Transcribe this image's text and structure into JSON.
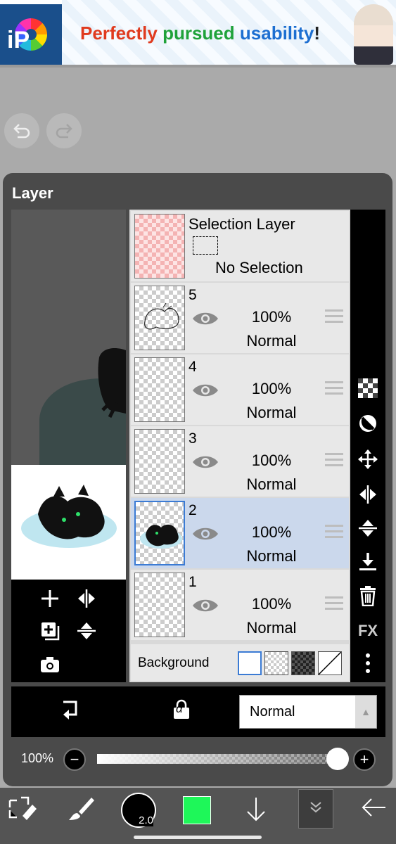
{
  "ad": {
    "logo_text": "iP",
    "headline_1": "Perfectly",
    "headline_2": "pursued",
    "headline_3": "usability",
    "headline_4": "!"
  },
  "history": {
    "undo_icon": "undo-icon",
    "redo_icon": "redo-icon"
  },
  "panel": {
    "title": "Layer",
    "selection_layer": {
      "name": "Selection Layer",
      "status": "No Selection"
    },
    "layers": [
      {
        "number": "5",
        "opacity": "100%",
        "blend": "Normal",
        "selected": false
      },
      {
        "number": "4",
        "opacity": "100%",
        "blend": "Normal",
        "selected": false
      },
      {
        "number": "3",
        "opacity": "100%",
        "blend": "Normal",
        "selected": false
      },
      {
        "number": "2",
        "opacity": "100%",
        "blend": "Normal",
        "selected": true
      },
      {
        "number": "1",
        "opacity": "100%",
        "blend": "Normal",
        "selected": false
      }
    ],
    "background": {
      "label": "Background",
      "selected_swatch": "white"
    },
    "side_tools": [
      "checker-icon",
      "contrast-icon",
      "move-icon",
      "flip-horizontal-icon",
      "flip-vertical-icon",
      "merge-down-icon",
      "trash-icon",
      "FX",
      "more-vertical-icon"
    ],
    "preview_tools": [
      "add-layer-icon",
      "flip-horizontal-icon",
      "duplicate-layer-icon",
      "flip-vertical-icon",
      "camera-icon"
    ]
  },
  "blend_bar": {
    "clip_icon": "clipping-icon",
    "alpha_lock_icon": "alpha-lock-icon",
    "alpha_symbol": "α",
    "blend_mode": "Normal"
  },
  "opacity": {
    "label": "100%",
    "minus": "−",
    "plus": "+",
    "value": 1.0
  },
  "toolbar": {
    "brush_size": "2.0",
    "color": "#1ef759",
    "accent": "#3b7bd4"
  }
}
